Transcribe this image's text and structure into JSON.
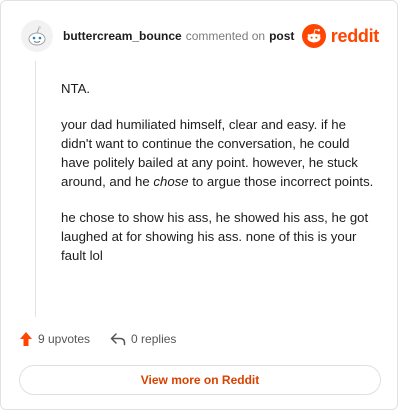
{
  "header": {
    "username": "buttercream_bounce",
    "commented_text": "commented on",
    "post_link": "post",
    "logo_text": "reddit"
  },
  "comment": {
    "paragraphs": [
      {
        "text": "NTA."
      },
      {
        "before": "your dad humiliated himself, clear and easy. if he didn't want to continue the conversation, he could have politely bailed at any point. however, he stuck around, and he ",
        "emphasis": "chose",
        "after": " to argue those incorrect points."
      },
      {
        "text": "he chose to show his ass, he showed his ass, he got laughed at for showing his ass. none of this is your fault lol"
      }
    ]
  },
  "actions": {
    "upvotes": "9 upvotes",
    "replies": "0 replies"
  },
  "view_more_label": "View more on Reddit",
  "colors": {
    "brand": "#ff4500",
    "button_text": "#d84200"
  },
  "icons": {
    "avatar": "snoo-avatar-icon",
    "logo": "reddit-logo-icon",
    "upvote": "upvote-arrow-icon",
    "reply": "reply-arrow-icon"
  }
}
